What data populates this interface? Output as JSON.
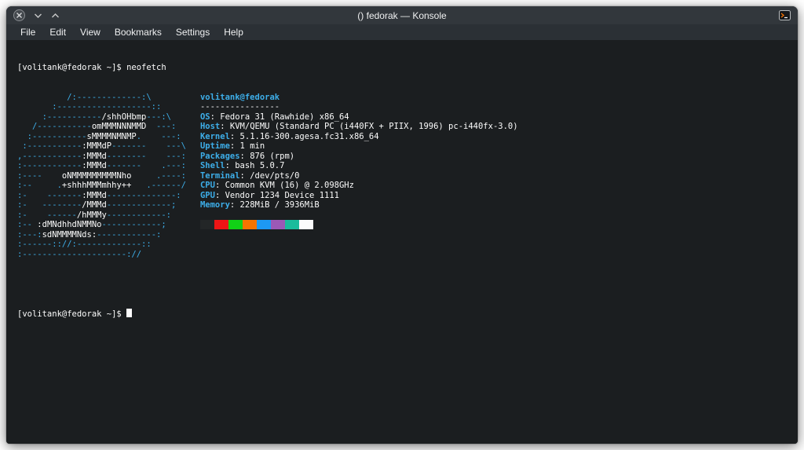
{
  "window": {
    "title": "() fedorak — Konsole"
  },
  "titlebar": {
    "icons": [
      "close-icon",
      "chevron-down-icon",
      "chevron-up-icon",
      "konsole-app-icon"
    ]
  },
  "menubar": {
    "items": [
      "File",
      "Edit",
      "View",
      "Bookmarks",
      "Settings",
      "Help"
    ]
  },
  "colors": {
    "accent_blue": "#3daee9",
    "terminal_background": "#1b1e20",
    "terminal_foreground": "#fcfcfc",
    "titlebar_background": "#32373c"
  },
  "terminal": {
    "first_prompt": "[volitank@fedorak ~]$ neofetch",
    "second_prompt": "[volitank@fedorak ~]$ ",
    "ascii": [
      [
        [
          "b",
          "          /:-------------:\\"
        ]
      ],
      [
        [
          "b",
          "       :-------------------::"
        ]
      ],
      [
        [
          "b",
          "     :-----------"
        ],
        [
          "w",
          "/shhOHbmp"
        ],
        [
          "b",
          "---:\\"
        ]
      ],
      [
        [
          "b",
          "   /-----------"
        ],
        [
          "w",
          "omMMMNNNMMD  "
        ],
        [
          "b",
          "---:"
        ]
      ],
      [
        [
          "b",
          "  :-----------"
        ],
        [
          "w",
          "sMMMMNMNMP"
        ],
        [
          "b",
          ".    ---:"
        ]
      ],
      [
        [
          "b",
          " :-----------"
        ],
        [
          "w",
          ":MMMdP"
        ],
        [
          "b",
          "-------    ---\\"
        ]
      ],
      [
        [
          "b",
          ",------------"
        ],
        [
          "w",
          ":MMMd"
        ],
        [
          "b",
          "--------    ---:"
        ]
      ],
      [
        [
          "b",
          ":------------"
        ],
        [
          "w",
          ":MMMd"
        ],
        [
          "b",
          "-------    .---:"
        ]
      ],
      [
        [
          "b",
          ":----    "
        ],
        [
          "w",
          "oNMMMMMMMMMNho"
        ],
        [
          "b",
          "     .----:"
        ]
      ],
      [
        [
          "b",
          ":--     ."
        ],
        [
          "w",
          "+shhhMMMmhhy++"
        ],
        [
          "b",
          "   .------/"
        ]
      ],
      [
        [
          "b",
          ":-    -------"
        ],
        [
          "w",
          ":MMMd"
        ],
        [
          "b",
          "--------------:"
        ]
      ],
      [
        [
          "b",
          ":-   --------"
        ],
        [
          "w",
          "/MMMd"
        ],
        [
          "b",
          "-------------;"
        ]
      ],
      [
        [
          "b",
          ":-    ------"
        ],
        [
          "w",
          "/hMMMy"
        ],
        [
          "b",
          "------------:"
        ]
      ],
      [
        [
          "b",
          ":-- "
        ],
        [
          "w",
          ":dMNdhhdNMMNo"
        ],
        [
          "b",
          "------------;"
        ]
      ],
      [
        [
          "b",
          ":---:"
        ],
        [
          "w",
          "sdNMMMMNds:"
        ],
        [
          "b",
          "------------:"
        ]
      ],
      [
        [
          "b",
          ":------:://:-------------::"
        ]
      ],
      [
        [
          "b",
          ":---------------------://"
        ]
      ]
    ],
    "info": {
      "title": "volitank@fedorak",
      "underline": "----------------",
      "rows": [
        {
          "label": "OS",
          "value": "Fedora 31 (Rawhide) x86_64"
        },
        {
          "label": "Host",
          "value": "KVM/QEMU (Standard PC (i440FX + PIIX, 1996) pc-i440fx-3.0)"
        },
        {
          "label": "Kernel",
          "value": "5.1.16-300.agesa.fc31.x86_64"
        },
        {
          "label": "Uptime",
          "value": "1 min"
        },
        {
          "label": "Packages",
          "value": "876 (rpm)"
        },
        {
          "label": "Shell",
          "value": "bash 5.0.7"
        },
        {
          "label": "Terminal",
          "value": "/dev/pts/0"
        },
        {
          "label": "CPU",
          "value": "Common KVM (16) @ 2.098GHz"
        },
        {
          "label": "GPU",
          "value": "Vendor 1234 Device 1111"
        },
        {
          "label": "Memory",
          "value": "228MiB / 3936MiB"
        }
      ]
    },
    "blocks": [
      "#232627",
      "#ed1515",
      "#11d116",
      "#f67400",
      "#1d99f3",
      "#9b59b6",
      "#1abc9c",
      "#fcfcfc"
    ]
  }
}
